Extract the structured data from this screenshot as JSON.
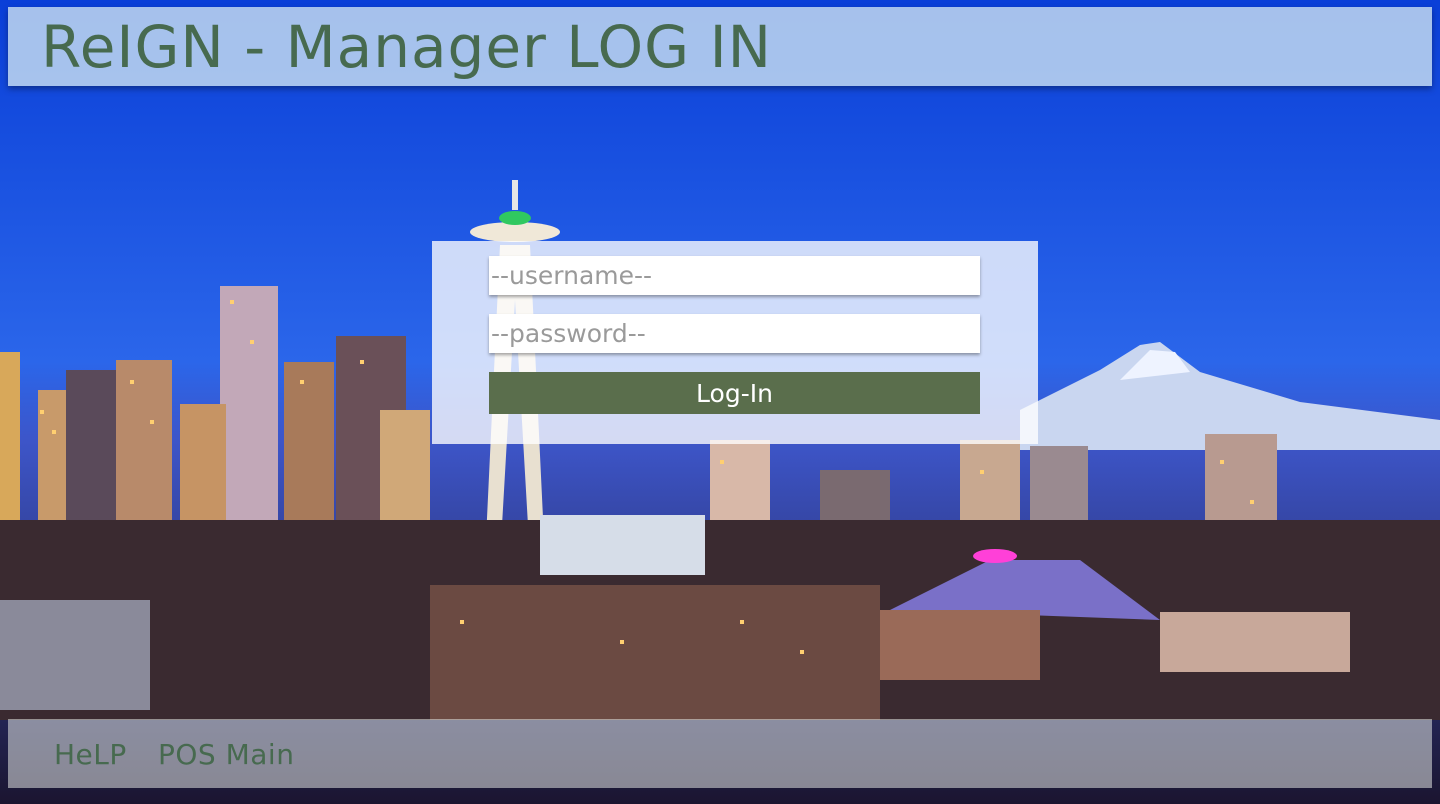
{
  "header": {
    "title": "ReIGN - Manager LOG IN"
  },
  "login": {
    "username_placeholder": "--username--",
    "password_placeholder": "--password--",
    "submit_label": "Log-In"
  },
  "footer": {
    "links": [
      {
        "label": "HeLP"
      },
      {
        "label": "POS Main"
      }
    ]
  },
  "colors": {
    "title_text": "#476a4f",
    "button_bg": "#5a6e4c",
    "button_text": "#ffffff",
    "sky_top": "#0a3fd8"
  }
}
